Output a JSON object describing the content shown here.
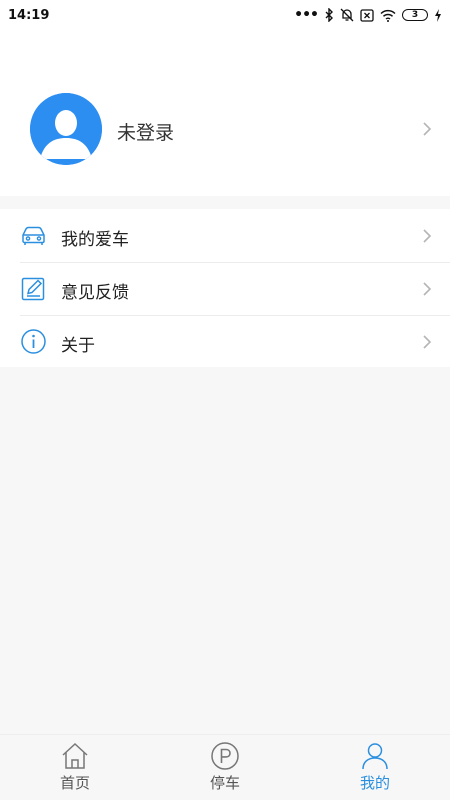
{
  "status_bar": {
    "time": "14:19",
    "dots": "•••",
    "battery": "3",
    "icons": [
      "bluetooth-icon",
      "mute-icon",
      "sim-icon",
      "wifi-icon",
      "battery-icon",
      "charging-icon"
    ]
  },
  "profile": {
    "name": "未登录",
    "avatar_icon": "default-avatar-icon"
  },
  "menu": {
    "items": [
      {
        "label": "我的爱车",
        "icon": "car-icon"
      },
      {
        "label": "意见反馈",
        "icon": "edit-icon"
      },
      {
        "label": "关于",
        "icon": "info-icon"
      }
    ]
  },
  "tab_bar": {
    "tabs": [
      {
        "label": "首页",
        "icon": "home-icon",
        "active": false
      },
      {
        "label": "停车",
        "icon": "parking-icon",
        "active": false
      },
      {
        "label": "我的",
        "icon": "user-icon",
        "active": true
      }
    ]
  },
  "colors": {
    "accent": "#2b8fe0",
    "avatar_bg": "#2d8ef2",
    "background": "#f7f7f7"
  }
}
